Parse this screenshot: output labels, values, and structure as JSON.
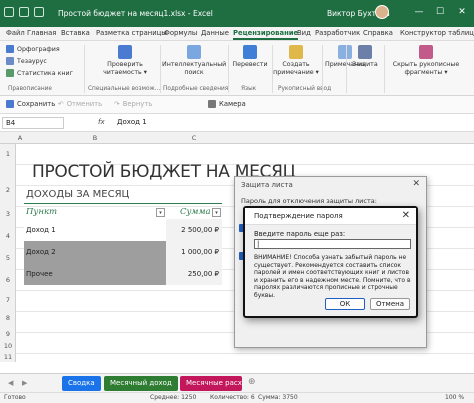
{
  "window": {
    "doc_title": "Простой бюджет на месяц1.xlsx  -  Excel",
    "user": "Виктор Бухтеев",
    "controls": [
      "—",
      "☐",
      "✕"
    ]
  },
  "menu": {
    "tabs": [
      "Файл",
      "Главная",
      "Вставка",
      "Разметка страницы",
      "Формулы",
      "Данные",
      "Рецензирование",
      "Вид",
      "Разработчик",
      "Справка",
      "Конструктор таблиц"
    ],
    "active_index": 6
  },
  "ribbon": {
    "spelling": "Орфография",
    "thesaurus": "Тезаурус",
    "stats": "Статистика книг",
    "readability_1": "Проверить",
    "readability_2": "читаемость ▾",
    "smart_1": "Интеллектуальный",
    "smart_2": "поиск",
    "translate": "Перевести",
    "comment_1": "Создать",
    "comment_2": "примечание ▾",
    "notes": "Примечания",
    "protect": "Защита",
    "hide_ink_1": "Скрыть рукописные",
    "hide_ink_2": "фрагменты ▾",
    "groups": [
      "Правописание",
      "Специальные возмож...",
      "Подробные сведения",
      "Язык",
      "Рукописный ввод"
    ]
  },
  "quick_bar": {
    "save": "Сохранить",
    "undo": "Отменить",
    "redo": "Вернуть",
    "camera": "Камера"
  },
  "formula": {
    "cell_ref": "B4",
    "fx": "fx",
    "content": "Доход 1"
  },
  "columns": [
    "A",
    "B",
    "C"
  ],
  "rows": [
    "1",
    "2",
    "3",
    "4",
    "5",
    "6",
    "7",
    "8",
    "9",
    "10",
    "11"
  ],
  "sheet": {
    "title": "ПРОСТОЙ БЮДЖЕТ НА МЕСЯЦ",
    "subtitle": "ДОХОДЫ ЗА МЕСЯЦ",
    "col_item": "Пункт",
    "col_sum": "Сумма",
    "rows": [
      {
        "item": "Доход 1",
        "sum": "2 500,00 ₽"
      },
      {
        "item": "Доход 2",
        "sum": "1 000,00 ₽"
      },
      {
        "item": "Прочее",
        "sum": "250,00 ₽"
      }
    ]
  },
  "protect_dialog": {
    "title": "Защита листа",
    "fragment": "Пароль для отключения защиты листа:",
    "close": "✕"
  },
  "confirm_dialog": {
    "title": "Подтверждение пароля",
    "close": "✕",
    "prompt": "Введите пароль еще раз:",
    "password_value": "|",
    "warning": "ВНИМАНИЕ! Способа узнать забытый пароль не существует. Рекомендуется составить список паролей и имен соответствующих книг и листов и хранить его в надежном месте. Помните, что в паролях различаются прописные и строчные буквы.",
    "ok": "ОК",
    "cancel": "Отмена"
  },
  "sheet_tabs": [
    {
      "label": "Сводка",
      "color": "#1a73e8"
    },
    {
      "label": "Месячный доход",
      "color": "#2e7d32"
    },
    {
      "label": "Месячные расх...",
      "color": "#c2185b"
    }
  ],
  "status": {
    "ready": "Готово",
    "count": "Среднее: 1250",
    "quantity": "Количество: 6",
    "sum": "Сумма: 3750",
    "zoom": "100 %"
  },
  "colors": {
    "accent": "#1e6e42",
    "table_green": "#2e7d4f",
    "selected_gray": "#9e9e9e"
  }
}
